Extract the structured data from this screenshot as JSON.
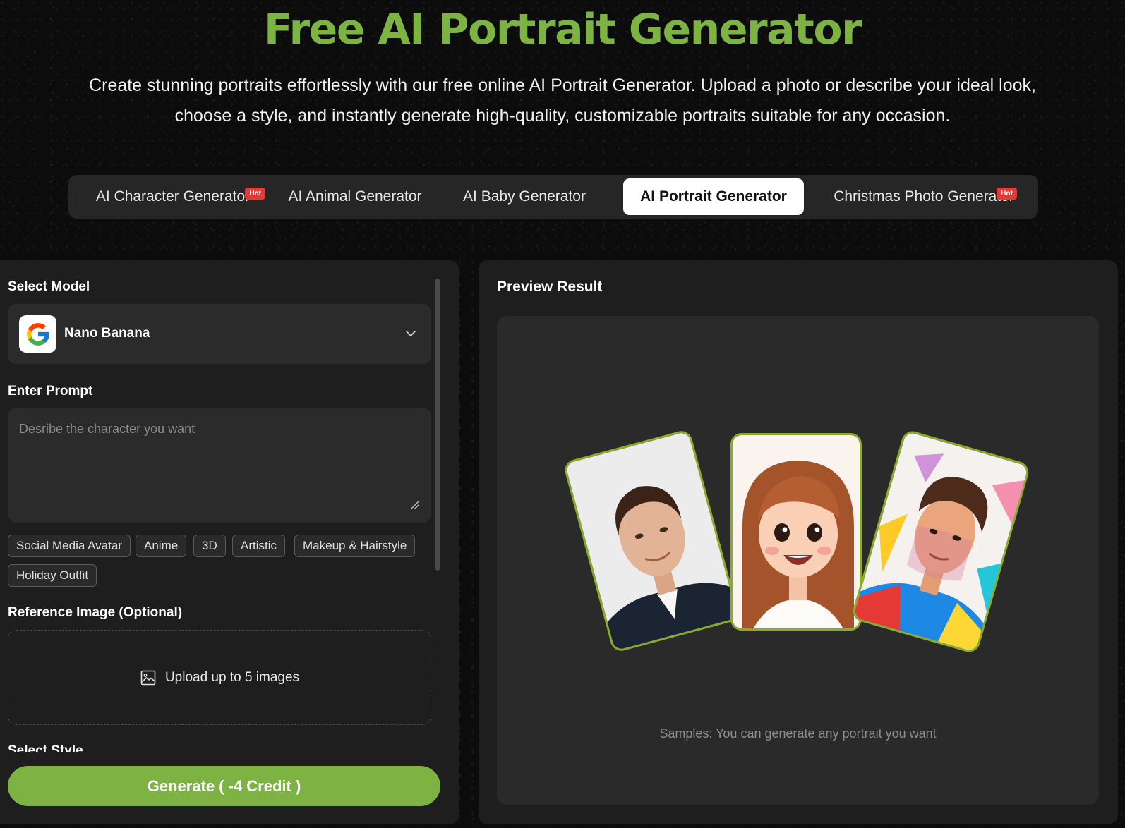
{
  "hero": {
    "title": "Free AI Portrait Generator",
    "subtitle": "Create stunning portraits effortlessly with our free online AI Portrait Generator. Upload a photo or describe your ideal look, choose a style, and instantly generate high-quality, customizable portraits suitable for any occasion."
  },
  "tabs": [
    {
      "label": "AI Character Generator",
      "badge": "Hot"
    },
    {
      "label": "AI Animal Generator"
    },
    {
      "label": "AI Baby Generator"
    },
    {
      "label": "AI Portrait Generator",
      "active": true
    },
    {
      "label": "Christmas Photo Generator",
      "badge": "Hot"
    }
  ],
  "form": {
    "model_label": "Select Model",
    "model_name": "Nano Banana",
    "model_icon": "google-icon",
    "prompt_label": "Enter Prompt",
    "prompt_placeholder": "Desribe the character you want",
    "chips": [
      "Social Media Avatar",
      "Anime",
      "3D",
      "Artistic",
      "Makeup & Hairstyle",
      "Holiday Outfit"
    ],
    "reference_label": "Reference Image (Optional)",
    "upload_text": "Upload up to 5 images",
    "style_label": "Select Style",
    "generate_label": "Generate ( -4 Credit )"
  },
  "preview": {
    "title": "Preview Result",
    "samples_note": "Samples: You can generate any portrait you want"
  },
  "colors": {
    "accent": "#7cb342",
    "card_border": "#8bab2c",
    "hot_badge": "#e53935"
  }
}
